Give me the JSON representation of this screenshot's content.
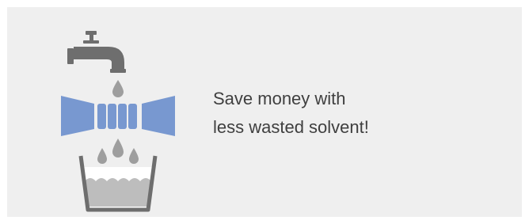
{
  "card": {
    "background": "#efefef",
    "tagline": {
      "line1": "Save money with",
      "line2": "less wasted solvent!"
    }
  },
  "illustration": {
    "icons": [
      "faucet-icon",
      "droplet-icon",
      "bowtie-filter-icon",
      "bucket-icon"
    ],
    "colors": {
      "faucet": "#6e6e6e",
      "droplet": "#9e9e9e",
      "filter": "#7898d0",
      "bucket_outline": "#6e6e6e",
      "liquid": "#bdbdbd"
    }
  }
}
